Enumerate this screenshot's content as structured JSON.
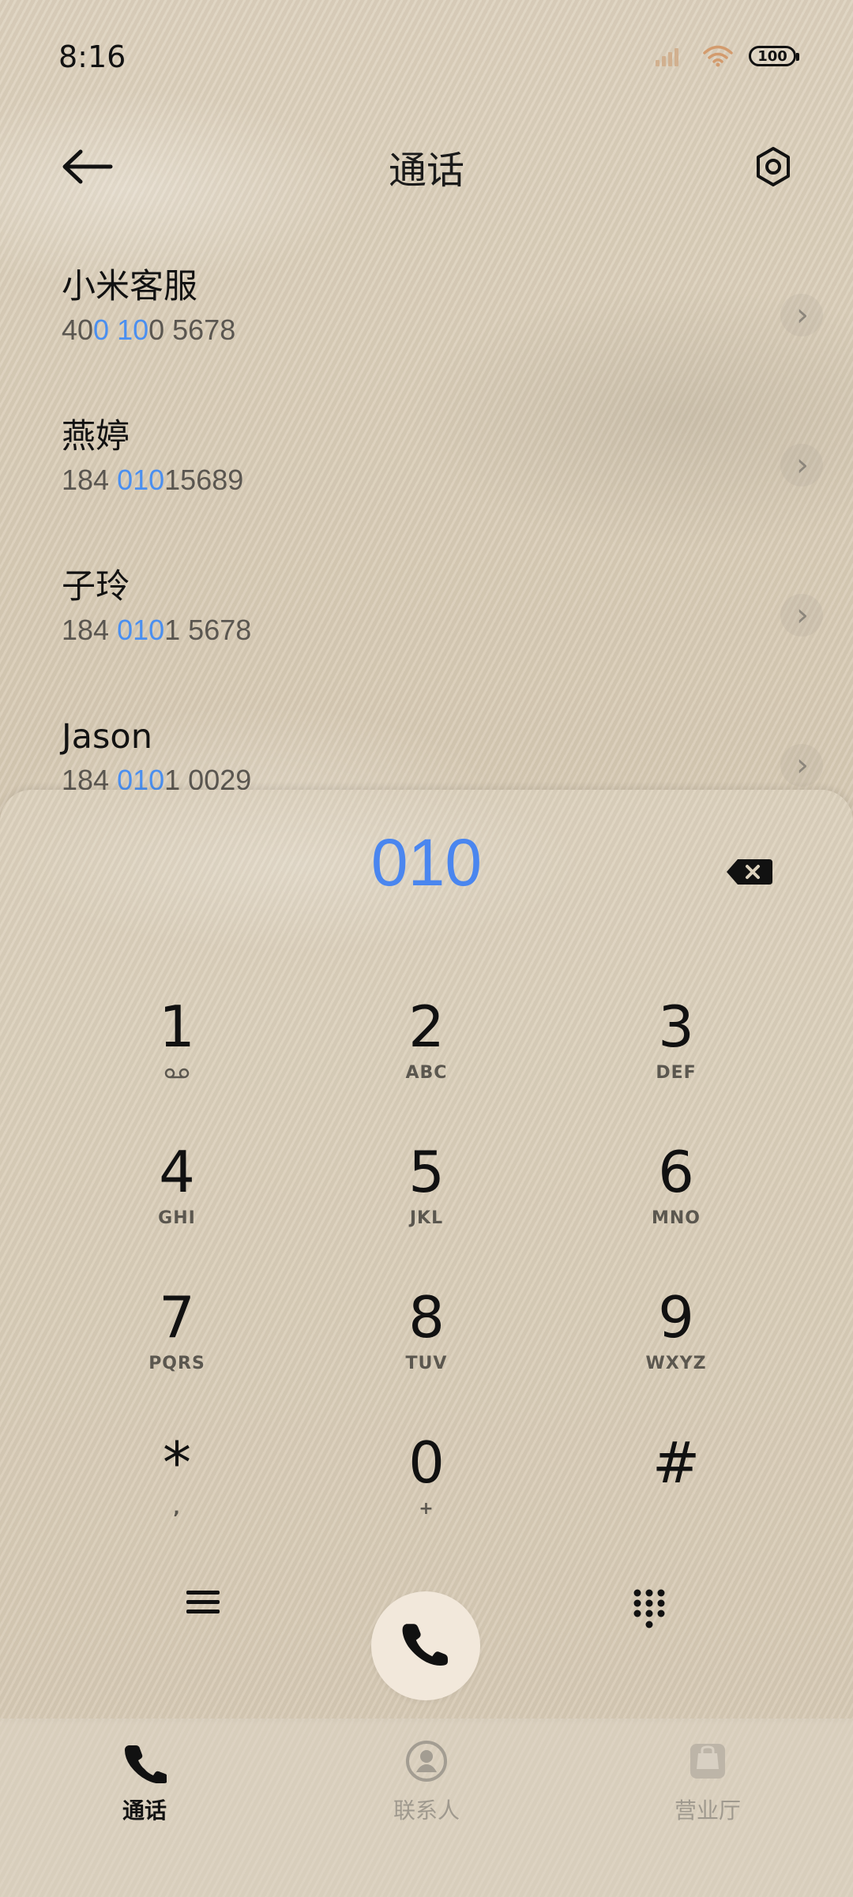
{
  "status_bar": {
    "time": "8:16",
    "battery": "100",
    "icons": [
      "signal-icon",
      "wifi-icon",
      "battery-icon"
    ]
  },
  "header": {
    "title": "通话",
    "icons": [
      "back-arrow-icon",
      "settings-icon"
    ]
  },
  "contacts": [
    {
      "name": "小米客服",
      "number_parts": [
        "40",
        "0",
        " ",
        "10",
        "0 5678"
      ]
    },
    {
      "name": "燕婷",
      "number_parts": [
        "184 ",
        "010",
        "15689",
        "",
        ""
      ]
    },
    {
      "name": "子玲",
      "number_parts": [
        "184 ",
        "010",
        "1 5678",
        "",
        ""
      ]
    },
    {
      "name": "Jason",
      "number_parts": [
        "184 ",
        "010",
        "1 0029",
        "",
        ""
      ]
    }
  ],
  "dialpad": {
    "input": "010",
    "keys": [
      {
        "digit": "1",
        "letters": ""
      },
      {
        "digit": "2",
        "letters": "ABC"
      },
      {
        "digit": "3",
        "letters": "DEF"
      },
      {
        "digit": "4",
        "letters": "GHI"
      },
      {
        "digit": "5",
        "letters": "JKL"
      },
      {
        "digit": "6",
        "letters": "MNO"
      },
      {
        "digit": "7",
        "letters": "PQRS"
      },
      {
        "digit": "8",
        "letters": "TUV"
      },
      {
        "digit": "9",
        "letters": "WXYZ"
      },
      {
        "digit": "*",
        "letters": ","
      },
      {
        "digit": "0",
        "letters": "+"
      },
      {
        "digit": "#",
        "letters": ""
      }
    ],
    "icons": [
      "backspace-icon",
      "voicemail-icon",
      "menu-icon",
      "phone-icon",
      "keypad-icon"
    ]
  },
  "bottom_nav": {
    "items": [
      {
        "label": "通话",
        "icon": "phone-icon",
        "active": true
      },
      {
        "label": "联系人",
        "icon": "contacts-icon",
        "active": false
      },
      {
        "label": "营业厅",
        "icon": "store-icon",
        "active": false
      }
    ]
  },
  "colors": {
    "accent": "#4a86ef",
    "text": "#121212",
    "muted": "#9f998e",
    "background": "#d8cbb6",
    "call_button": "#f2e8db"
  }
}
